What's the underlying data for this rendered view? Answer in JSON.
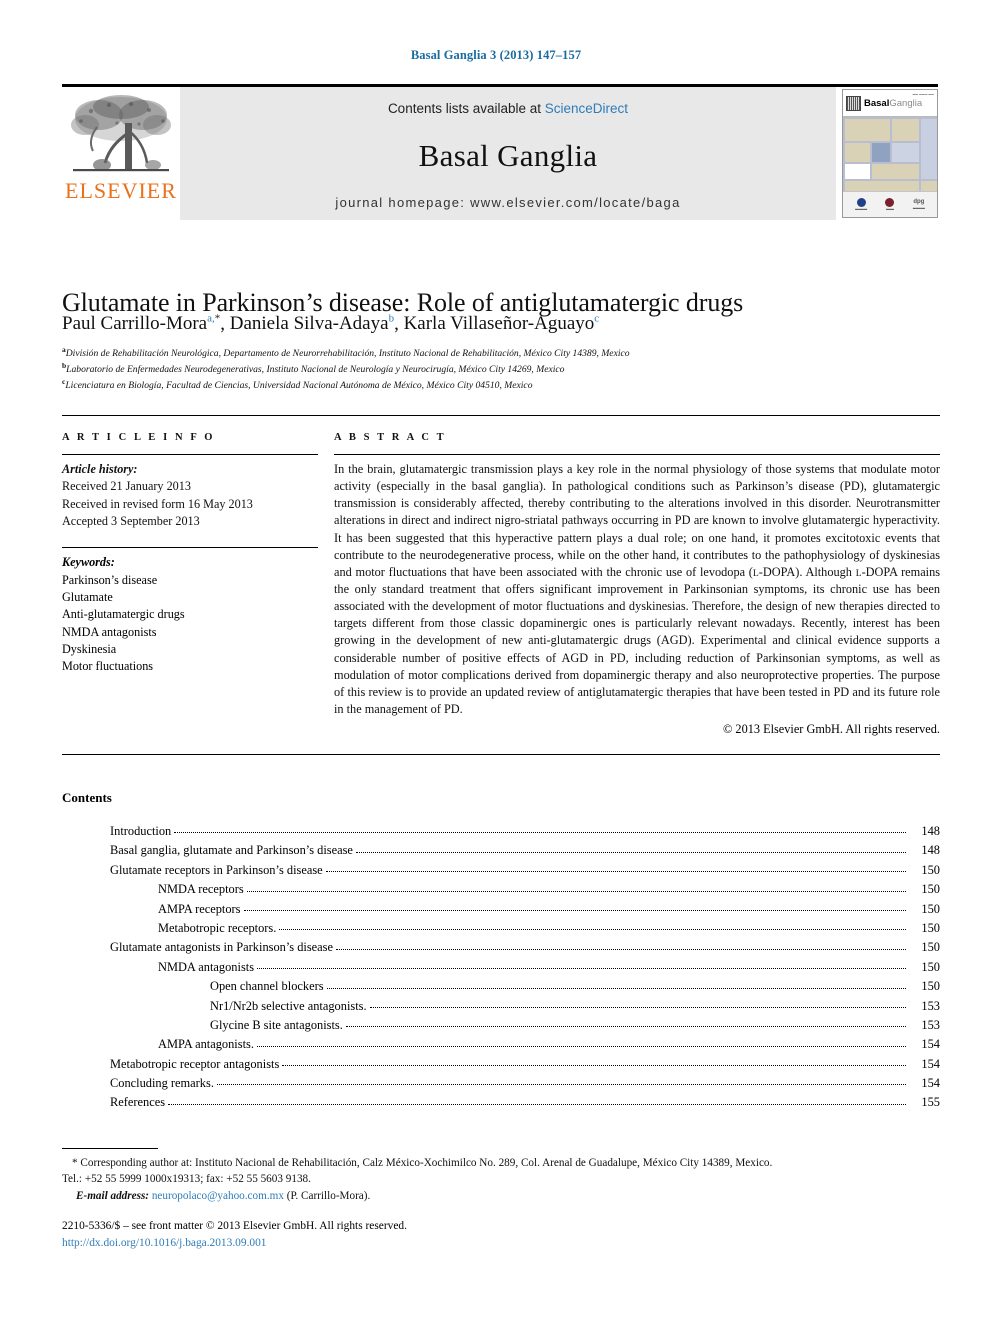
{
  "running_head": "Basal Ganglia 3 (2013) 147–157",
  "masthead": {
    "publisher_logo_text": "ELSEVIER",
    "contents_prefix": "Contents lists available at ",
    "sciencedirect_link": "ScienceDirect",
    "journal_name": "Basal Ganglia",
    "homepage_line": "journal homepage: www.elsevier.com/locate/baga",
    "cover": {
      "title_bold": "Basal",
      "title_light": "Ganglia",
      "tiny_header": "OFFICIAL JOURNAL OF THE ...",
      "footer_left": "",
      "footer_right": "dpg"
    }
  },
  "article": {
    "title": "Glutamate in Parkinson’s disease: Role of antiglutamatergic drugs",
    "authors": [
      {
        "name": "Paul Carrillo-Mora",
        "sup": "a,",
        "star": "*"
      },
      {
        "name": "Daniela Silva-Adaya",
        "sup": "b"
      },
      {
        "name": "Karla Villaseñor-Aguayo",
        "sup": "c"
      }
    ],
    "affiliations": [
      {
        "mark": "a",
        "text": "División de Rehabilitación Neurológica, Departamento de Neurorrehabilitación, Instituto Nacional de Rehabilitación, México City 14389, Mexico"
      },
      {
        "mark": "b",
        "text": "Laboratorio de Enfermedades Neurodegenerativas, Instituto Nacional de Neurología y Neurocirugía, México City 14269, Mexico"
      },
      {
        "mark": "c",
        "text": "Licenciatura en Biología, Facultad de Ciencias, Universidad Nacional Autónoma de México, México City 04510, Mexico"
      }
    ]
  },
  "article_info": {
    "heading": "A R T I C L E   I N F O",
    "history_label": "Article history:",
    "history": [
      "Received 21 January 2013",
      "Received in revised form 16 May 2013",
      "Accepted 3 September 2013"
    ],
    "keywords_label": "Keywords:",
    "keywords": [
      "Parkinson’s disease",
      "Glutamate",
      "Anti-glutamatergic drugs",
      "NMDA antagonists",
      "Dyskinesia",
      "Motor fluctuations"
    ]
  },
  "abstract": {
    "heading": "A B S T R A C T",
    "part1": "In the brain, glutamatergic transmission plays a key role in the normal physiology of those systems that modulate motor activity (especially in the basal ganglia). In pathological conditions such as Parkinson’s disease (PD), glutamatergic transmission is considerably affected, thereby contributing to the alterations involved in this disorder. Neurotransmitter alterations in direct and indirect nigro-striatal pathways occurring in PD are known to involve glutamatergic hyperactivity. It has been suggested that this hyperactive pattern plays a dual role; on one hand, it promotes excitotoxic events that contribute to the neurodegenerative process, while on the other hand, it contributes to the pathophysiology of dyskinesias and motor fluctuations that have been associated with the chronic use of levodopa (",
    "ldopa1": "L",
    "part2": "-DOPA). Although ",
    "ldopa2": "L",
    "part3": "-DOPA remains the only standard treatment that offers significant improvement in Parkinsonian symptoms, its chronic use has been associated with the development of motor fluctuations and dyskinesias. Therefore, the design of new therapies directed to targets different from those classic dopaminergic ones is particularly relevant nowadays. Recently, interest has been growing in the development of new anti-glutamatergic drugs (AGD). Experimental and clinical evidence supports a considerable number of positive effects of AGD in PD, including reduction of Parkinsonian symptoms, as well as modulation of motor complications derived from dopaminergic therapy and also neuroprotective properties. The purpose of this review is to provide an updated review of antiglutamatergic therapies that have been tested in PD and its future role in the management of PD.",
    "copyright": "© 2013 Elsevier GmbH. All rights reserved."
  },
  "contents": {
    "heading": "Contents",
    "entries": [
      {
        "label": "Introduction",
        "page": "148",
        "level": 0
      },
      {
        "label": "Basal ganglia, glutamate and Parkinson’s disease",
        "page": "148",
        "level": 0
      },
      {
        "label": "Glutamate receptors in Parkinson’s disease",
        "page": "150",
        "level": 0
      },
      {
        "label": "NMDA receptors",
        "page": "150",
        "level": 1
      },
      {
        "label": "AMPA receptors",
        "page": "150",
        "level": 1
      },
      {
        "label": "Metabotropic receptors.",
        "page": "150",
        "level": 1
      },
      {
        "label": "Glutamate antagonists in Parkinson’s disease",
        "page": "150",
        "level": 0
      },
      {
        "label": "NMDA antagonists",
        "page": "150",
        "level": 1
      },
      {
        "label": "Open channel blockers",
        "page": "150",
        "level": 2
      },
      {
        "label": "Nr1/Nr2b selective antagonists.",
        "page": "153",
        "level": 2
      },
      {
        "label": "Glycine B site antagonists.",
        "page": "153",
        "level": 2
      },
      {
        "label": "AMPA antagonists.",
        "page": "154",
        "level": 1
      },
      {
        "label": "Metabotropic receptor antagonists",
        "page": "154",
        "level": 0
      },
      {
        "label": "Concluding remarks.",
        "page": "154",
        "level": 0
      },
      {
        "label": "References",
        "page": "155",
        "level": 0
      }
    ]
  },
  "footnotes": {
    "corresponding_line1": "* Corresponding author at: Instituto Nacional de Rehabilitación, Calz México-Xochimilco No. 289, Col. Arenal de Guadalupe, México City 14389, Mexico.",
    "corresponding_line2": "Tel.: +52 55 5999 1000x19313; fax: +52 55 5603 9138.",
    "email_label": "E-mail address:",
    "email": "neuropolaco@yahoo.com.mx",
    "email_owner": "(P. Carrillo-Mora).",
    "front_matter": "2210-5336/$ – see front matter © 2013 Elsevier GmbH. All rights reserved.",
    "doi": "http://dx.doi.org/10.1016/j.baga.2013.09.001"
  },
  "colors": {
    "link_blue": "#2E7CB8",
    "running_head_blue": "#1a6ba0",
    "elsevier_orange": "#E9711C",
    "masthead_gray": "#e8e8e8"
  }
}
